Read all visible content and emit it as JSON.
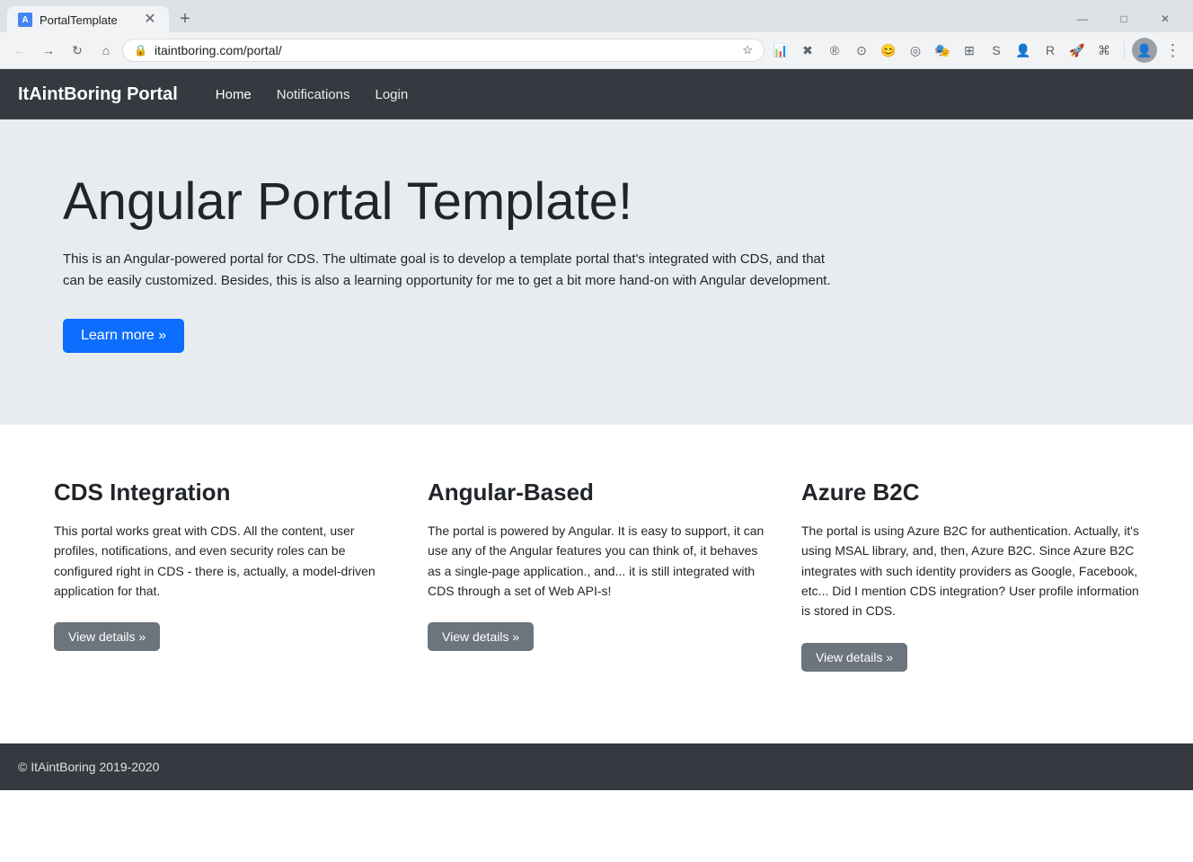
{
  "browser": {
    "tab_title": "PortalTemplate",
    "new_tab_label": "+",
    "url": "itaintboring.com/portal/",
    "window_controls": {
      "minimize": "—",
      "maximize": "□",
      "close": "✕"
    },
    "nav": {
      "back": "←",
      "forward": "→",
      "refresh": "↻",
      "home": "⌂"
    }
  },
  "navbar": {
    "brand": "ItAintBoring Portal",
    "links": [
      {
        "label": "Home",
        "active": true
      },
      {
        "label": "Notifications",
        "active": false
      },
      {
        "label": "Login",
        "active": false
      }
    ]
  },
  "hero": {
    "title": "Angular Portal Template!",
    "description": "This is an Angular-powered portal for CDS. The ultimate goal is to develop a template portal that's integrated with CDS, and that can be easily customized. Besides, this is also a learning opportunity for me to get a bit more hand-on with Angular development.",
    "cta_label": "Learn more »"
  },
  "features": [
    {
      "id": "cds",
      "title": "CDS Integration",
      "description": "This portal works great with CDS. All the content, user profiles, notifications, and even security roles can be configured right in CDS - there is, actually, a model-driven application for that.",
      "button_label": "View details »"
    },
    {
      "id": "angular",
      "title": "Angular-Based",
      "description": "The portal is powered by Angular. It is easy to support, it can use any of the Angular features you can think of, it behaves as a single-page application., and... it is still integrated with CDS through a set of Web API-s!",
      "button_label": "View details »"
    },
    {
      "id": "azure",
      "title": "Azure B2C",
      "description": "The portal is using Azure B2C for authentication. Actually, it's using MSAL library, and, then, Azure B2C. Since Azure B2C integrates with such identity providers as Google, Facebook, etc... Did I mention CDS integration? User profile information is stored in CDS.",
      "button_label": "View details »"
    }
  ],
  "footer": {
    "text": "© ItAintBoring 2019-2020"
  }
}
